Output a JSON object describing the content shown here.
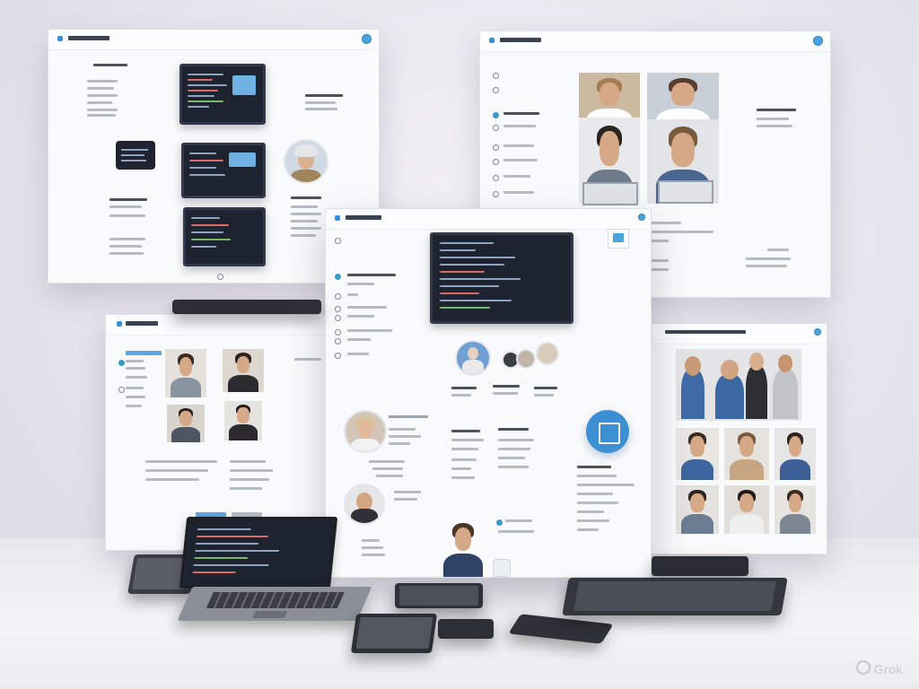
{
  "scene": {
    "background_color": "#e6e4ec",
    "accent_color": "#3d8fd4",
    "code_bg_color": "#1e2330"
  },
  "watermark": {
    "text": "Grok",
    "icon": "grok-logo-icon"
  }
}
